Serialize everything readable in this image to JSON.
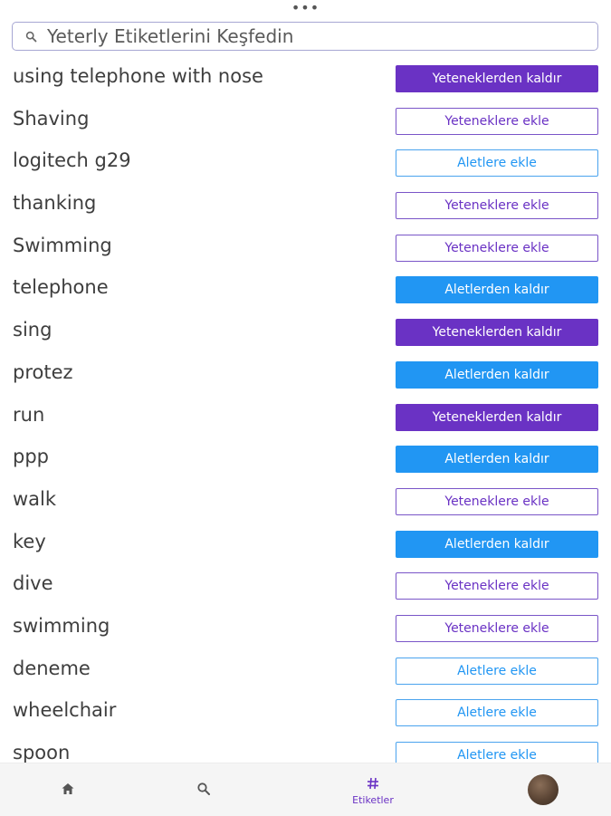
{
  "header": {
    "more_glyph": "•••"
  },
  "search": {
    "placeholder": "Yeterly Etiketlerini Keşfedin",
    "icon": "search-icon"
  },
  "tags": [
    {
      "label": "using telephone with nose",
      "action": "Yeteneklerden kaldır",
      "kind": "skill-remove"
    },
    {
      "label": "Shaving",
      "action": "Yeteneklere ekle",
      "kind": "skill-add"
    },
    {
      "label": "logitech g29",
      "action": "Aletlere ekle",
      "kind": "tool-add"
    },
    {
      "label": "thanking",
      "action": "Yeteneklere ekle",
      "kind": "skill-add"
    },
    {
      "label": "Swimming",
      "action": "Yeteneklere ekle",
      "kind": "skill-add"
    },
    {
      "label": "telephone",
      "action": "Aletlerden kaldır",
      "kind": "tool-remove"
    },
    {
      "label": "sing",
      "action": "Yeteneklerden kaldır",
      "kind": "skill-remove"
    },
    {
      "label": "protez",
      "action": "Aletlerden kaldır",
      "kind": "tool-remove"
    },
    {
      "label": "run",
      "action": "Yeteneklerden kaldır",
      "kind": "skill-remove"
    },
    {
      "label": "ppp",
      "action": "Aletlerden kaldır",
      "kind": "tool-remove"
    },
    {
      "label": "walk",
      "action": "Yeteneklere ekle",
      "kind": "skill-add"
    },
    {
      "label": "key",
      "action": "Aletlerden kaldır",
      "kind": "tool-remove"
    },
    {
      "label": "dive",
      "action": "Yeteneklere ekle",
      "kind": "skill-add"
    },
    {
      "label": "swimming",
      "action": "Yeteneklere ekle",
      "kind": "skill-add"
    },
    {
      "label": "deneme",
      "action": "Aletlere ekle",
      "kind": "tool-add"
    },
    {
      "label": "wheelchair",
      "action": "Aletlere ekle",
      "kind": "tool-add"
    },
    {
      "label": "spoon",
      "action": "Aletlere ekle",
      "kind": "tool-add"
    }
  ],
  "bottom_nav": {
    "items": [
      {
        "icon": "home-icon",
        "label": ""
      },
      {
        "icon": "search-icon",
        "label": ""
      },
      {
        "icon": "hashtag-icon",
        "label": "Etiketler",
        "active": true
      },
      {
        "icon": "avatar",
        "label": ""
      }
    ]
  },
  "colors": {
    "skill": "#6a32c4",
    "tool": "#2196f3",
    "active_nav": "#6a32c4"
  }
}
